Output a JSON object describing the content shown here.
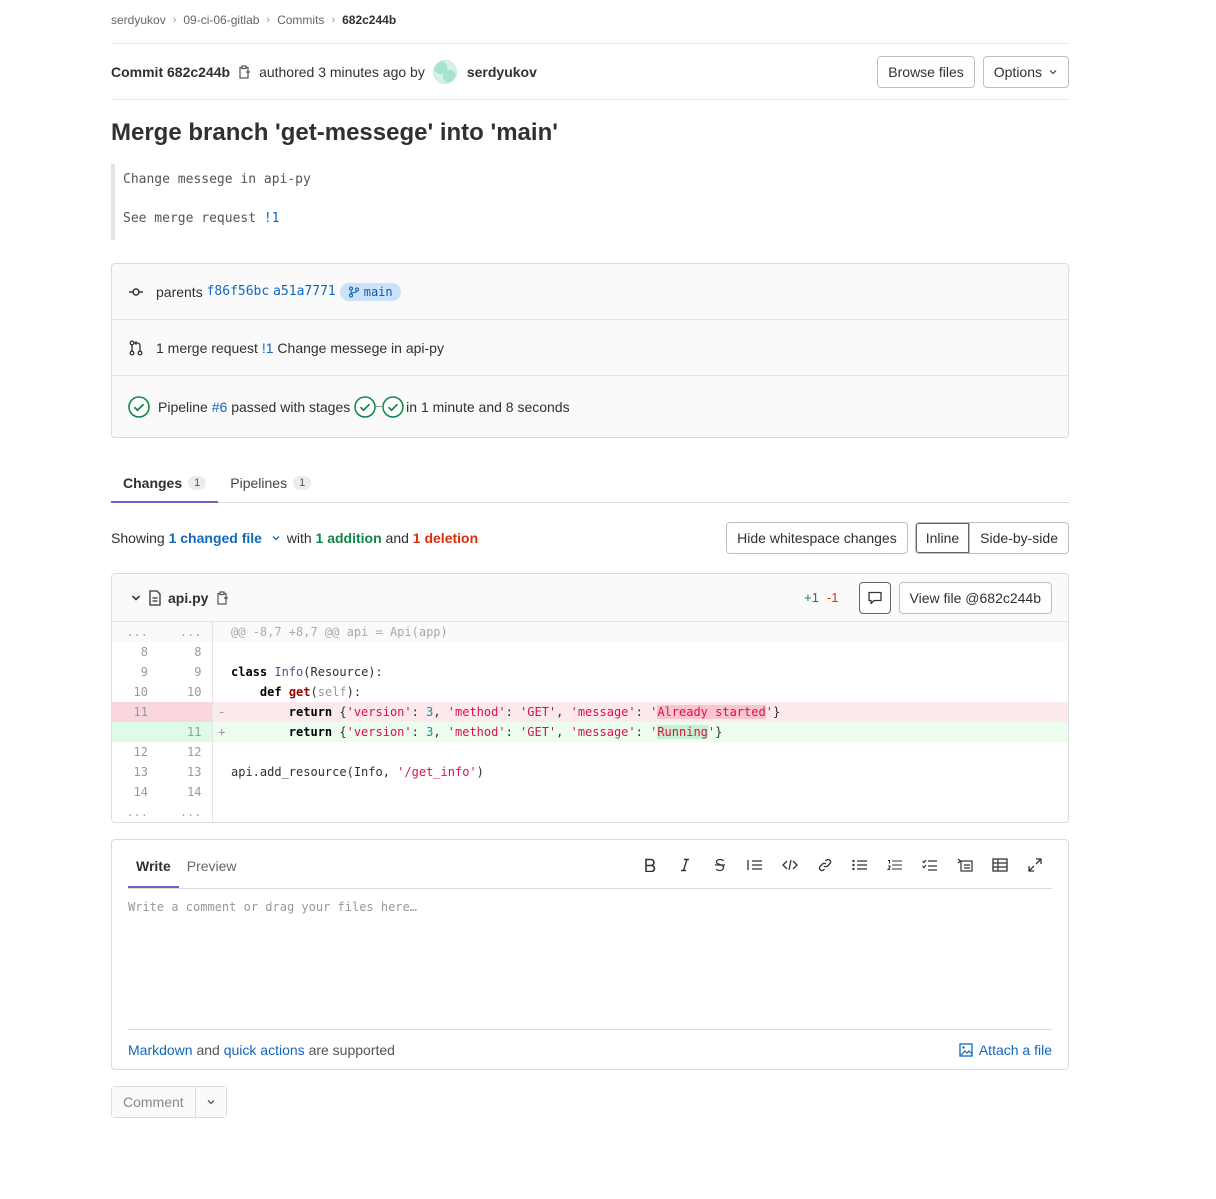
{
  "breadcrumb": [
    "serdyukov",
    "09-ci-06-gitlab",
    "Commits",
    "682c244b"
  ],
  "commit": {
    "label": "Commit 682c244b",
    "authored": "authored 3 minutes ago by",
    "author": "serdyukov",
    "browse_files": "Browse files",
    "options": "Options"
  },
  "title": "Merge branch 'get-messege' into 'main'",
  "description": {
    "line1": "Change messege in api-py",
    "line2_prefix": "See merge request ",
    "line2_link": "!1"
  },
  "info": {
    "parents_label": "parents",
    "parent1": "f86f56bc",
    "parent2": "a51a7771",
    "branch": "main",
    "mr_prefix": "1 merge request",
    "mr_link": "!1",
    "mr_title": "Change messege in api-py",
    "pipeline_label": "Pipeline",
    "pipeline_link": "#6",
    "pipeline_status": "passed with stages",
    "pipeline_duration": "in 1 minute and 8 seconds"
  },
  "tabs": [
    {
      "label": "Changes",
      "count": "1"
    },
    {
      "label": "Pipelines",
      "count": "1"
    }
  ],
  "stats": {
    "showing": "Showing",
    "changed_files": "1 changed file",
    "with": "with",
    "additions": "1 addition",
    "and": "and",
    "deletions": "1 deletion",
    "hide_whitespace": "Hide whitespace changes",
    "inline": "Inline",
    "side_by_side": "Side-by-side"
  },
  "file": {
    "name": "api.py",
    "added": "+1",
    "removed": "-1",
    "view_file": "View file @682c244b",
    "hunk_header": "@@ -8,7 +8,7 @@ api = Api(app)",
    "lines": [
      {
        "old": "8",
        "new": "8"
      },
      {
        "old": "9",
        "new": "9"
      },
      {
        "old": "10",
        "new": "10"
      },
      {
        "old": "11",
        "new": ""
      },
      {
        "old": "",
        "new": "11"
      },
      {
        "old": "12",
        "new": "12"
      },
      {
        "old": "13",
        "new": "13"
      },
      {
        "old": "14",
        "new": "14"
      }
    ],
    "ellipsis": "..."
  },
  "note": {
    "write": "Write",
    "preview": "Preview",
    "placeholder": "Write a comment or drag your files here…",
    "markdown": "Markdown",
    "and": "and",
    "quick_actions": "quick actions",
    "supported": "are supported",
    "attach": "Attach a file",
    "submit": "Comment"
  }
}
